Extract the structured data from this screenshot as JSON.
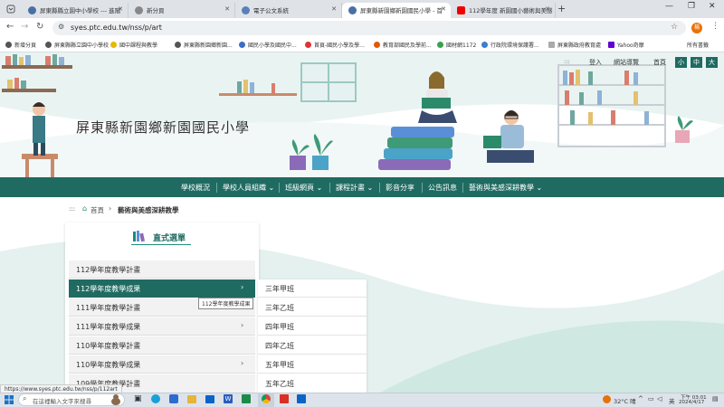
{
  "browser": {
    "tabs": [
      {
        "label": "屏東縣縣立園中小學校 --- 進階"
      },
      {
        "label": "新分頁"
      },
      {
        "label": "電子公文系統"
      },
      {
        "label": "屏東縣新園鄉新園國民小學 - 首"
      },
      {
        "label": "112學年度 新園國小藝術與美感"
      }
    ],
    "new_tab": "+",
    "url": "syes.ptc.edu.tw/nss/p/art",
    "bookmarks": [
      "新增分頁",
      "屏東縣縣立園中小學校",
      "國中課程與教學",
      "屏東縣新園鄉新園...",
      "國民小學及國民中...",
      "首頁-國民小學及學...",
      "教育部國民及學前...",
      "國材網1172",
      "行政院環境保護署...",
      "屏東縣政府教育處",
      "Yahoo奇摩"
    ],
    "all_bookmarks": "所有書籤",
    "profile_initial": "楊"
  },
  "site": {
    "title": "屏東縣新園鄉新園國民小學",
    "top_links": [
      "登入",
      "網站導覽",
      "首頁"
    ],
    "font_sizes": [
      "小",
      "中",
      "大"
    ],
    "nav": [
      {
        "label": "學校概況",
        "dropdown": false
      },
      {
        "label": "學校人員組織",
        "dropdown": true
      },
      {
        "label": "班級網頁",
        "dropdown": true
      },
      {
        "label": "課程計畫",
        "dropdown": true
      },
      {
        "label": "影音分享",
        "dropdown": false
      },
      {
        "label": "公告訊息",
        "dropdown": false
      },
      {
        "label": "藝術與美感深耕教學",
        "dropdown": true
      }
    ],
    "breadcrumb": {
      "home": "首頁",
      "current": "藝術與美感深耕教學",
      "dots": ":::"
    }
  },
  "sidemenu": {
    "title": "直式選單",
    "items": [
      {
        "label": "112學年度教學計畫",
        "active": false,
        "arrow": false
      },
      {
        "label": "112學年度教學成果",
        "active": true,
        "arrow": true
      },
      {
        "label": "111學年度教學計畫",
        "active": false,
        "arrow": false
      },
      {
        "label": "111學年度教學成果",
        "active": false,
        "arrow": true
      },
      {
        "label": "110學年度教學計畫",
        "active": false,
        "arrow": false
      },
      {
        "label": "110學年度教學成果",
        "active": false,
        "arrow": true
      },
      {
        "label": "109學年度教學計畫",
        "active": false,
        "arrow": false
      }
    ],
    "tooltip": "112學年度教學成果",
    "submenu": [
      "三年甲班",
      "三年乙班",
      "四年甲班",
      "四年乙班",
      "五年甲班",
      "五年乙班"
    ]
  },
  "statusbar": {
    "url": "https://www.syes.ptc.edu.tw/nss/p/112art"
  },
  "taskbar": {
    "search_placeholder": "在這裡輸入文字來搜尋",
    "weather": "32°C 晴",
    "ime": "英",
    "time": "下午 03:01",
    "date": "2024/4/17"
  },
  "colors": {
    "nav": "#1f6b62",
    "accent": "#1f8a7a",
    "tab_bar": "#dfe3e8"
  }
}
